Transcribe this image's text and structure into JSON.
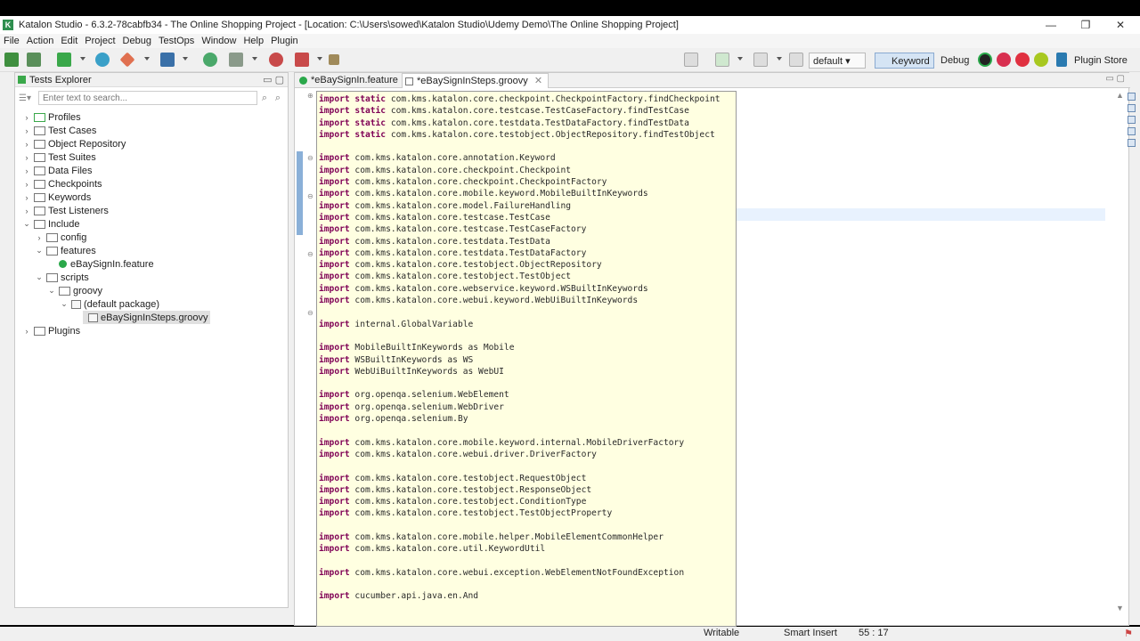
{
  "window": {
    "title": "Katalon Studio - 6.3.2-78cabfb34 - The Online Shopping Project - [Location: C:\\Users\\sowed\\Katalon Studio\\Udemy Demo\\The Online Shopping Project]",
    "minimize": "—",
    "restore": "❐",
    "close": "✕"
  },
  "menu": [
    "File",
    "Action",
    "Edit",
    "Project",
    "Debug",
    "TestOps",
    "Window",
    "Help",
    "Plugin"
  ],
  "toolbar": {
    "profile": "default",
    "keyword": "Keyword",
    "debug": "Debug",
    "plugin_store": "Plugin Store"
  },
  "explorer": {
    "title": "Tests Explorer",
    "search_placeholder": "Enter text to search...",
    "items": [
      {
        "label": "Profiles"
      },
      {
        "label": "Test Cases"
      },
      {
        "label": "Object Repository"
      },
      {
        "label": "Test Suites"
      },
      {
        "label": "Data Files"
      },
      {
        "label": "Checkpoints"
      },
      {
        "label": "Keywords"
      },
      {
        "label": "Test Listeners"
      },
      {
        "label": "Include"
      },
      {
        "label": "config"
      },
      {
        "label": "features"
      },
      {
        "label": "eBaySignIn.feature"
      },
      {
        "label": "scripts"
      },
      {
        "label": "groovy"
      },
      {
        "label": "(default package)"
      },
      {
        "label": "eBaySignInSteps.groovy"
      },
      {
        "label": "Plugins"
      }
    ]
  },
  "editor": {
    "tabs": [
      {
        "label": "*eBaySignIn.feature"
      },
      {
        "label": "*eBaySignInSteps.groovy"
      }
    ],
    "lines": [
      {
        "kw": "import static",
        "text": " com.kms.katalon.core.checkpoint.CheckpointFactory.findCheckpoint"
      },
      {
        "kw": "import static",
        "text": " com.kms.katalon.core.testcase.TestCaseFactory.findTestCase"
      },
      {
        "kw": "import static",
        "text": " com.kms.katalon.core.testdata.TestDataFactory.findTestData"
      },
      {
        "kw": "import static",
        "text": " com.kms.katalon.core.testobject.ObjectRepository.findTestObject"
      },
      {
        "kw": "",
        "text": ""
      },
      {
        "kw": "import",
        "text": " com.kms.katalon.core.annotation.Keyword"
      },
      {
        "kw": "import",
        "text": " com.kms.katalon.core.checkpoint.Checkpoint"
      },
      {
        "kw": "import",
        "text": " com.kms.katalon.core.checkpoint.CheckpointFactory"
      },
      {
        "kw": "import",
        "text": " com.kms.katalon.core.mobile.keyword.MobileBuiltInKeywords"
      },
      {
        "kw": "import",
        "text": " com.kms.katalon.core.model.FailureHandling"
      },
      {
        "kw": "import",
        "text": " com.kms.katalon.core.testcase.TestCase"
      },
      {
        "kw": "import",
        "text": " com.kms.katalon.core.testcase.TestCaseFactory"
      },
      {
        "kw": "import",
        "text": " com.kms.katalon.core.testdata.TestData"
      },
      {
        "kw": "import",
        "text": " com.kms.katalon.core.testdata.TestDataFactory"
      },
      {
        "kw": "import",
        "text": " com.kms.katalon.core.testobject.ObjectRepository"
      },
      {
        "kw": "import",
        "text": " com.kms.katalon.core.testobject.TestObject"
      },
      {
        "kw": "import",
        "text": " com.kms.katalon.core.webservice.keyword.WSBuiltInKeywords"
      },
      {
        "kw": "import",
        "text": " com.kms.katalon.core.webui.keyword.WebUiBuiltInKeywords"
      },
      {
        "kw": "",
        "text": ""
      },
      {
        "kw": "import",
        "text": " internal.GlobalVariable"
      },
      {
        "kw": "",
        "text": ""
      },
      {
        "kw": "import",
        "text": " MobileBuiltInKeywords as Mobile"
      },
      {
        "kw": "import",
        "text": " WSBuiltInKeywords as WS"
      },
      {
        "kw": "import",
        "text": " WebUiBuiltInKeywords as WebUI"
      },
      {
        "kw": "",
        "text": ""
      },
      {
        "kw": "import",
        "text": " org.openqa.selenium.WebElement"
      },
      {
        "kw": "import",
        "text": " org.openqa.selenium.WebDriver"
      },
      {
        "kw": "import",
        "text": " org.openqa.selenium.By"
      },
      {
        "kw": "",
        "text": ""
      },
      {
        "kw": "import",
        "text": " com.kms.katalon.core.mobile.keyword.internal.MobileDriverFactory"
      },
      {
        "kw": "import",
        "text": " com.kms.katalon.core.webui.driver.DriverFactory"
      },
      {
        "kw": "",
        "text": ""
      },
      {
        "kw": "import",
        "text": " com.kms.katalon.core.testobject.RequestObject"
      },
      {
        "kw": "import",
        "text": " com.kms.katalon.core.testobject.ResponseObject"
      },
      {
        "kw": "import",
        "text": " com.kms.katalon.core.testobject.ConditionType"
      },
      {
        "kw": "import",
        "text": " com.kms.katalon.core.testobject.TestObjectProperty"
      },
      {
        "kw": "",
        "text": ""
      },
      {
        "kw": "import",
        "text": " com.kms.katalon.core.mobile.helper.MobileElementCommonHelper"
      },
      {
        "kw": "import",
        "text": " com.kms.katalon.core.util.KeywordUtil"
      },
      {
        "kw": "",
        "text": ""
      },
      {
        "kw": "import",
        "text": " com.kms.katalon.core.webui.exception.WebElementNotFoundException"
      },
      {
        "kw": "",
        "text": ""
      },
      {
        "kw": "import",
        "text": " cucumber.api.java.en.And"
      }
    ]
  },
  "status": {
    "mode": "Writable",
    "insert": "Smart Insert",
    "position": "55 : 17"
  },
  "colors": {
    "code_bg": "#ffffe1",
    "keyword": "#7f0055",
    "accent": "#2aa84a"
  }
}
